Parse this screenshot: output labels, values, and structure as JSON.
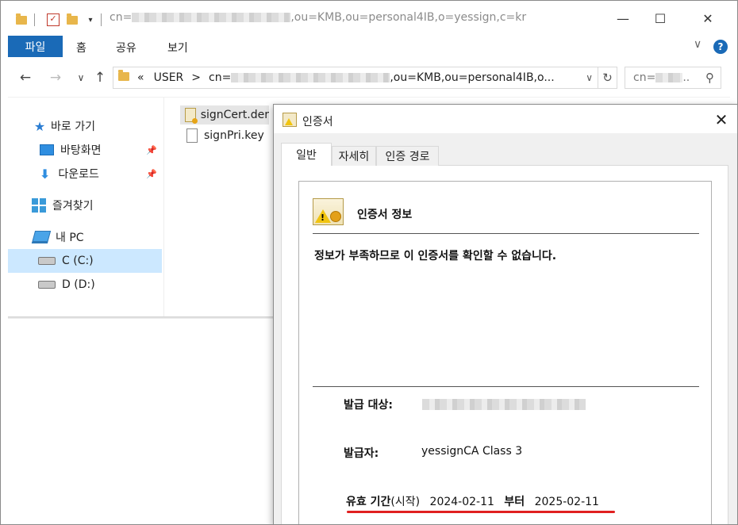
{
  "window": {
    "title_prefix": "cn=",
    "title_suffix": ",ou=KMB,ou=personal4IB,o=yessign,c=kr",
    "minimize": "—",
    "maximize": "☐",
    "close": "✕"
  },
  "ribbon": {
    "tabs": [
      "파일",
      "홈",
      "공유",
      "보기"
    ],
    "expand": "∨",
    "help": "?"
  },
  "address": {
    "back": "←",
    "forward": "→",
    "recent": "∨",
    "up": "↑",
    "chevron": "«",
    "crumb_user": "USER",
    "crumb_sep": ">",
    "crumb_prefix": "cn=",
    "crumb_suffix": ",ou=KMB,ou=personal4IB,o...",
    "dropdown": "∨",
    "refresh": "↻",
    "search_prefix": "cn=",
    "search_suffix": "..",
    "search_icon": "⚲"
  },
  "nav": {
    "quick_access": "바로 가기",
    "desktop": "바탕화면",
    "downloads": "다운로드",
    "favorites": "즐겨찾기",
    "this_pc": "내 PC",
    "drive_c": "C (C:)",
    "drive_d": "D (D:)"
  },
  "files": [
    {
      "name": "signCert.der",
      "icon": "certificate-icon",
      "selected": true
    },
    {
      "name": "signPri.key",
      "icon": "file-icon",
      "selected": false
    }
  ],
  "dialog": {
    "title": "인증서",
    "close": "✕",
    "tabs": [
      "일반",
      "자세히",
      "인증 경로"
    ],
    "section_title": "인증서 정보",
    "warning": "정보가 부족하므로 이 인증서를 확인할 수 없습니다.",
    "issued_to_label": "발급 대상:",
    "issued_by_label": "발급자:",
    "issued_by_value": "yessignCA Class 3",
    "validity_label": "유효 기간",
    "validity_start_label": "(시작)",
    "valid_from": "2024-02-11",
    "from_word": "부터",
    "valid_to": "2025-02-11"
  },
  "colors": {
    "accent": "#1a6ab7",
    "selected_nav": "#cce8ff",
    "highlight_underline": "#e02020"
  }
}
